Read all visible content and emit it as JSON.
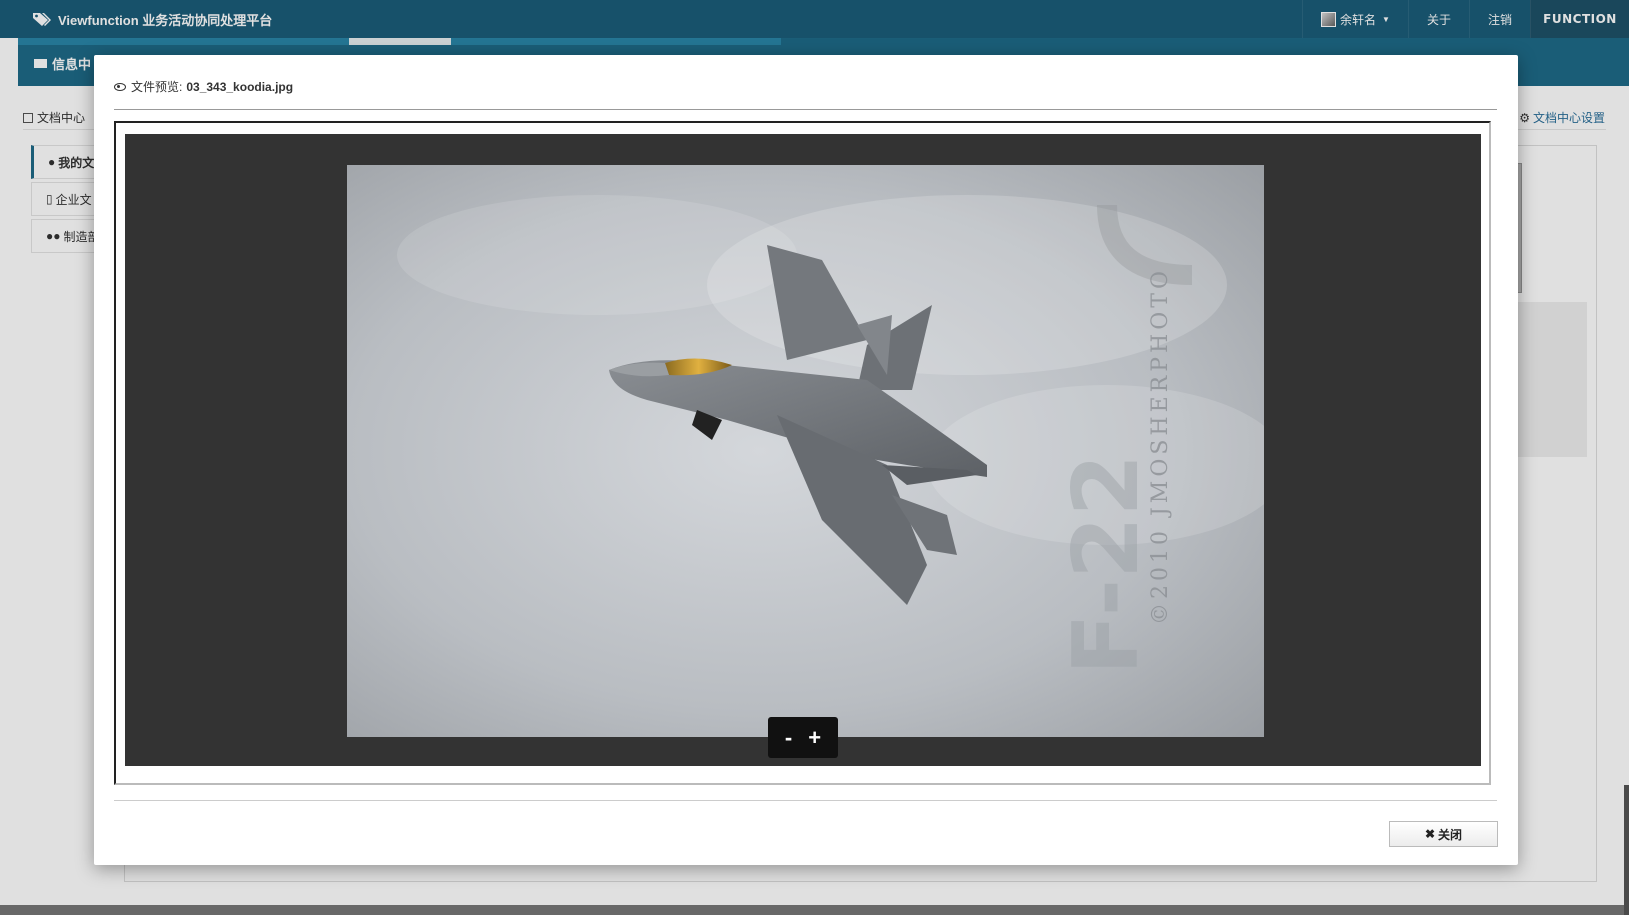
{
  "app": {
    "title": "Viewfunction 业务活动协同处理平台",
    "logo_text": "FUNCTION"
  },
  "topnav": {
    "user_name": "余轩名",
    "about": "关于",
    "logout": "注销"
  },
  "subnav": {
    "message_tab": "信息中"
  },
  "background": {
    "page_title": "文档中心",
    "settings_link": "文档中心设置",
    "sidebar": [
      {
        "label": "我的文",
        "icon": "user-icon"
      },
      {
        "label": "企业文",
        "icon": "building-icon"
      },
      {
        "label": "制造部",
        "icon": "group-icon"
      }
    ]
  },
  "modal": {
    "header_prefix": "文件预览:",
    "file_name": "03_343_koodia.jpg",
    "zoom_out": "-",
    "zoom_in": "+",
    "close_label": "关闭"
  },
  "colors": {
    "navbar": "#1b5d79",
    "subbar": "#1e6a88",
    "viewer_bg": "#333333"
  }
}
